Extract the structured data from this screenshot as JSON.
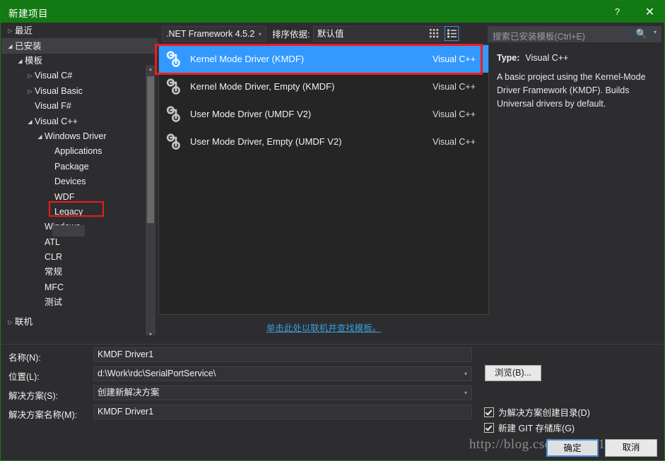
{
  "window": {
    "title": "新建项目",
    "help_label": "?",
    "close_label": "✕",
    "accent_green": "#137A13",
    "background": "#2d2d30",
    "selection_blue": "#3399ff",
    "highlight_red": "#ef1b1b"
  },
  "sidebar": {
    "items": [
      {
        "label": "最近",
        "arrow": "▷",
        "indent": 0,
        "state": "collapsed"
      },
      {
        "label": "已安装",
        "arrow": "◢",
        "indent": 0,
        "state": "expanded"
      },
      {
        "label": "模板",
        "arrow": "◢",
        "indent": 1,
        "state": "expanded"
      },
      {
        "label": "Visual C#",
        "arrow": "▷",
        "indent": 2,
        "state": "collapsed"
      },
      {
        "label": "Visual Basic",
        "arrow": "▷",
        "indent": 2,
        "state": "collapsed"
      },
      {
        "label": "Visual F#",
        "arrow": "",
        "indent": 2,
        "state": "leaf"
      },
      {
        "label": "Visual C++",
        "arrow": "◢",
        "indent": 2,
        "state": "expanded"
      },
      {
        "label": "Windows Driver",
        "arrow": "◢",
        "indent": 3,
        "state": "expanded"
      },
      {
        "label": "Applications",
        "arrow": "",
        "indent": 4,
        "state": "leaf"
      },
      {
        "label": "Package",
        "arrow": "",
        "indent": 4,
        "state": "leaf"
      },
      {
        "label": "Devices",
        "arrow": "",
        "indent": 4,
        "state": "leaf"
      },
      {
        "label": "WDF",
        "arrow": "",
        "indent": 4,
        "state": "selected"
      },
      {
        "label": "Legacy",
        "arrow": "",
        "indent": 4,
        "state": "leaf"
      },
      {
        "label": "Windows",
        "arrow": "",
        "indent": 3,
        "state": "leaf"
      },
      {
        "label": "ATL",
        "arrow": "",
        "indent": 3,
        "state": "leaf"
      },
      {
        "label": "CLR",
        "arrow": "",
        "indent": 3,
        "state": "leaf"
      },
      {
        "label": "常规",
        "arrow": "",
        "indent": 3,
        "state": "leaf"
      },
      {
        "label": "MFC",
        "arrow": "",
        "indent": 3,
        "state": "leaf"
      },
      {
        "label": "测试",
        "arrow": "",
        "indent": 3,
        "state": "leaf"
      },
      {
        "label": "联机",
        "arrow": "▷",
        "indent": 0,
        "state": "collapsed"
      }
    ],
    "selected_item": "WDF"
  },
  "toolbar": {
    "framework": ".NET Framework 4.5.2",
    "sort_label": "排序依据:",
    "sort_value": "默认值",
    "view_grid_icon": "grid-view-icon",
    "view_list_icon": "list-view-icon",
    "caret": "▾"
  },
  "search": {
    "placeholder": "搜索已安装模板(Ctrl+E)",
    "icon": "search-icon",
    "caret": "▾"
  },
  "templates": {
    "items": [
      {
        "name": "Kernel Mode Driver (KMDF)",
        "language": "Visual C++",
        "icon": "driver-node-icon",
        "selected": true
      },
      {
        "name": "Kernel Mode Driver, Empty (KMDF)",
        "language": "Visual C++",
        "icon": "driver-node-icon",
        "selected": false
      },
      {
        "name": "User Mode Driver (UMDF V2)",
        "language": "Visual C++",
        "icon": "driver-node-icon",
        "selected": false
      },
      {
        "name": "User Mode Driver, Empty (UMDF V2)",
        "language": "Visual C++",
        "icon": "driver-node-icon",
        "selected": false
      }
    ],
    "online_link": "单击此处以联机并查找模板。"
  },
  "description": {
    "type_label": "Type:",
    "type_value": "Visual C++",
    "text": "A basic project using the Kernel-Mode Driver Framework (KMDF). Builds Universal drivers by default."
  },
  "form": {
    "name_label": "名称(N):",
    "name_value": "KMDF Driver1",
    "location_label": "位置(L):",
    "location_value": "d:\\Work\\rdc\\SerialPortService\\",
    "solution_label": "解决方案(S):",
    "solution_value": "创建新解决方案",
    "solution_name_label": "解决方案名称(M):",
    "solution_name_value": "KMDF Driver1",
    "browse_label": "浏览(B)...",
    "caret": "▾"
  },
  "options": {
    "create_dir_label": "为解决方案创建目录(D)",
    "create_dir_checked": true,
    "git_repo_label": "新建 GIT 存储库(G)",
    "git_repo_checked": true
  },
  "footer": {
    "ok_label": "确定",
    "cancel_label": "取消",
    "watermark": "http://blog.csdn.net/u013222"
  }
}
